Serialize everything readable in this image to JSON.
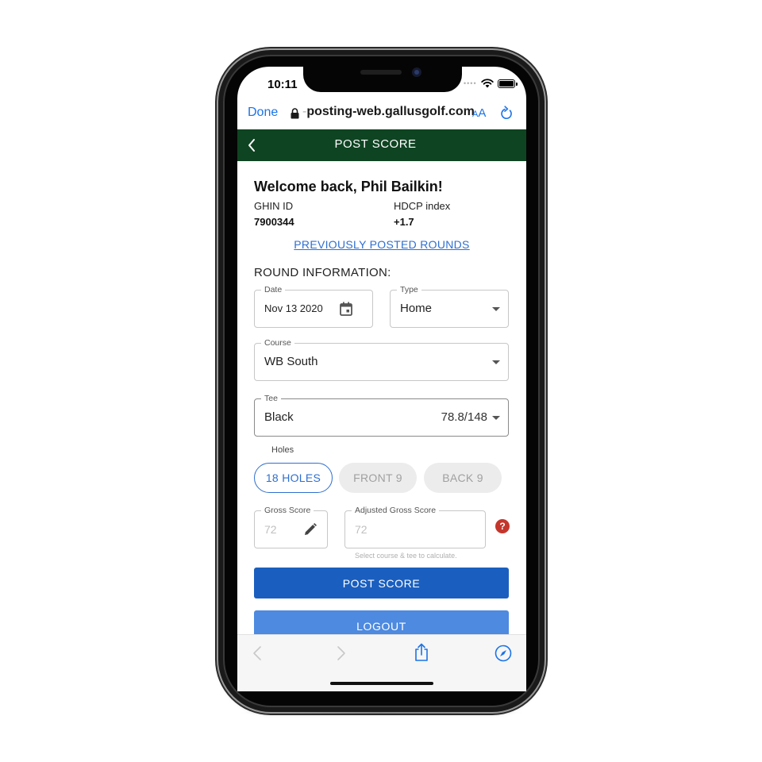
{
  "status_bar": {
    "time": "10:11"
  },
  "browser": {
    "done_label": "Done",
    "url_prefix": "-",
    "url": "posting-web.gallusgolf.com",
    "text_size_label_small": "A",
    "text_size_label_large": "A"
  },
  "app_header": {
    "title": "POST SCORE"
  },
  "welcome": {
    "greeting": "Welcome back, Phil Bailkin!",
    "ghin_label": "GHIN ID",
    "ghin_value": "7900344",
    "hdcp_label": "HDCP index",
    "hdcp_value": "+1.7"
  },
  "previous_rounds_link": "PREVIOUSLY POSTED ROUNDS",
  "round_info": {
    "heading": "ROUND INFORMATION:",
    "date": {
      "label": "Date",
      "value": "Nov 13 2020"
    },
    "type": {
      "label": "Type",
      "value": "Home"
    },
    "course": {
      "label": "Course",
      "value": "WB South"
    },
    "tee": {
      "label": "Tee",
      "value": "Black",
      "rating": "78.8/148"
    },
    "holes": {
      "label": "Holes",
      "options": [
        "18 HOLES",
        "FRONT 9",
        "BACK 9"
      ],
      "selected": "18 HOLES"
    },
    "gross_score": {
      "label": "Gross Score",
      "placeholder": "72"
    },
    "adjusted_gross_score": {
      "label": "Adjusted Gross Score",
      "placeholder": "72"
    },
    "help_symbol": "?",
    "calc_note": "Select course & tee to calculate."
  },
  "actions": {
    "post_score": "POST SCORE",
    "logout": "LOGOUT"
  },
  "colors": {
    "header_green": "#0f4422",
    "primary_blue": "#1a5fbf",
    "link_blue": "#2f6fd0",
    "help_red": "#c4362c"
  },
  "icons": {
    "lock": "lock-icon",
    "reload": "reload-icon",
    "back": "chevron-left-icon",
    "calendar": "calendar-icon",
    "dropdown": "caret-down-icon",
    "pencil": "pencil-icon",
    "help": "help-icon",
    "nav_back": "chevron-left-icon",
    "nav_forward": "chevron-right-icon",
    "share": "share-icon",
    "compass": "compass-icon"
  }
}
